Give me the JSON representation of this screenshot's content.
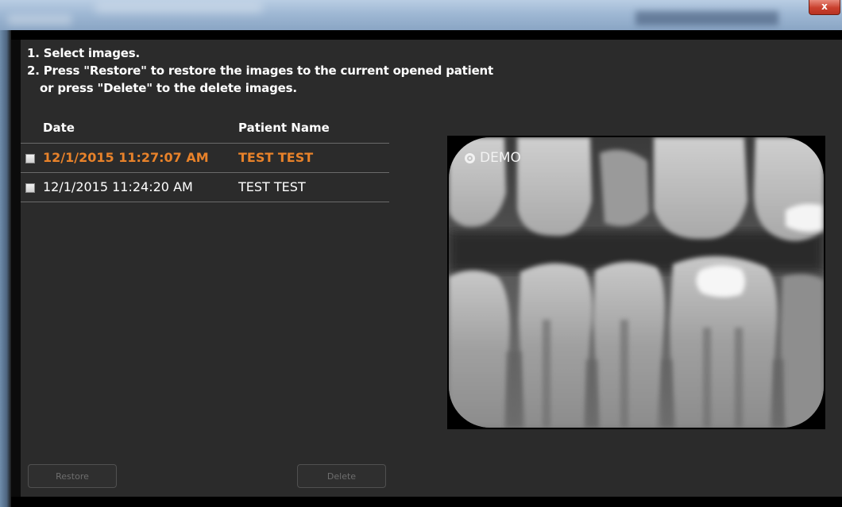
{
  "window": {
    "close_label": "x"
  },
  "instructions": {
    "line1": "1. Select images.",
    "line2": "2. Press \"Restore\" to restore the images to the current opened patient",
    "line3": "or press \"Delete\" to the delete images."
  },
  "table": {
    "headers": {
      "date": "Date",
      "patient_name": "Patient Name"
    },
    "rows": [
      {
        "date": "12/1/2015 11:27:07 AM",
        "patient_name": "TEST TEST",
        "selected": true,
        "checked": false
      },
      {
        "date": "12/1/2015 11:24:20 AM",
        "patient_name": "TEST TEST",
        "selected": false,
        "checked": false
      }
    ]
  },
  "preview": {
    "watermark": "DEMO"
  },
  "buttons": {
    "restore": "Restore",
    "delete": "Delete",
    "enabled": false
  },
  "colors": {
    "selected_row_text": "#e8822a",
    "panel_background": "#2b2b2b",
    "text": "#ffffff",
    "disabled_button_text": "#6e6e6e"
  }
}
